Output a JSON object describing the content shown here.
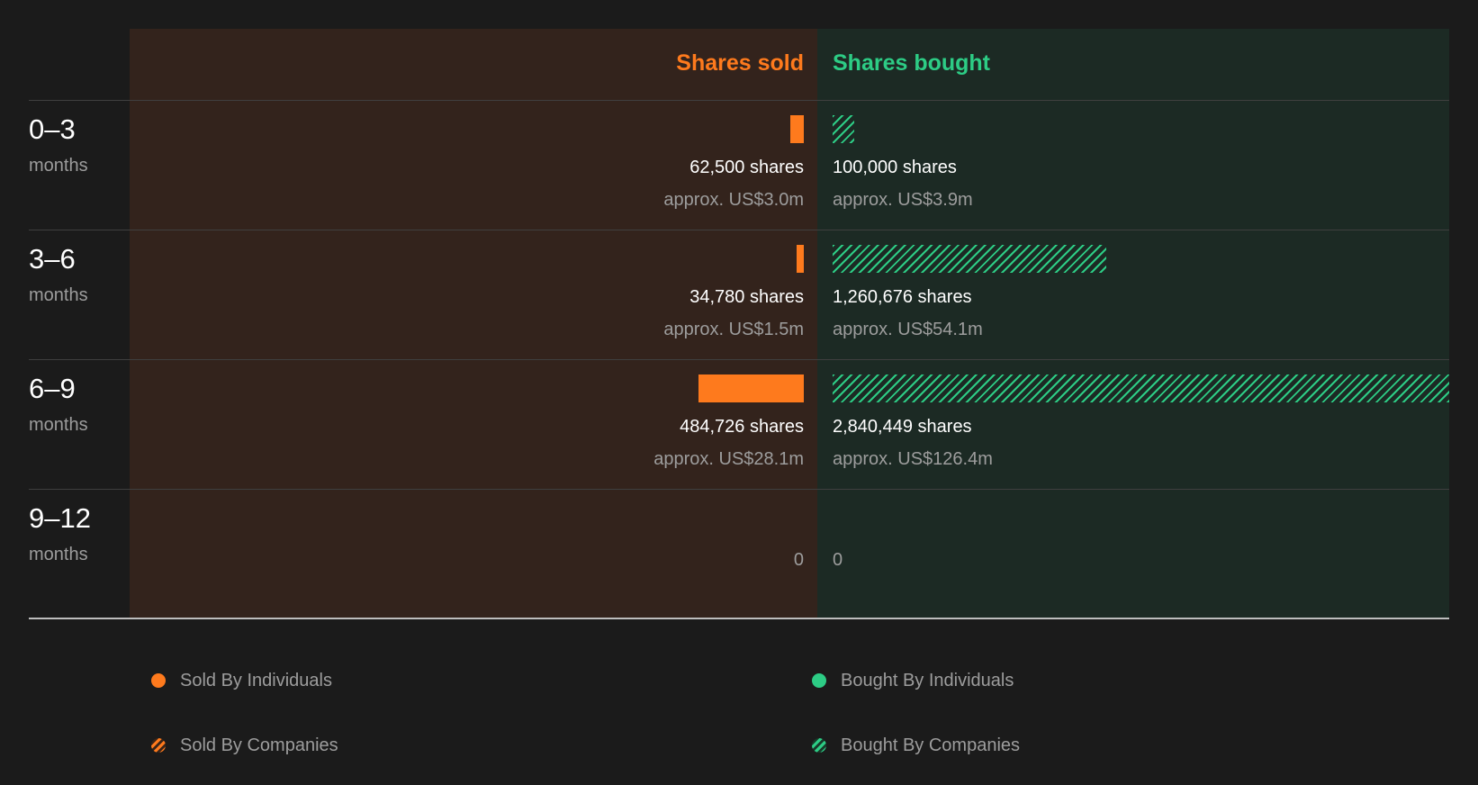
{
  "chart_data": {
    "type": "bar",
    "headers": {
      "sold": "Shares sold",
      "bought": "Shares bought"
    },
    "periods": [
      {
        "range": "0–3",
        "unit": "months",
        "sold": {
          "shares": 62500,
          "shares_label": "62,500 shares",
          "approx_label": "approx. US$3.0m"
        },
        "bought": {
          "shares": 100000,
          "shares_label": "100,000 shares",
          "approx_label": "approx. US$3.9m"
        }
      },
      {
        "range": "3–6",
        "unit": "months",
        "sold": {
          "shares": 34780,
          "shares_label": "34,780 shares",
          "approx_label": "approx. US$1.5m"
        },
        "bought": {
          "shares": 1260676,
          "shares_label": "1,260,676 shares",
          "approx_label": "approx. US$54.1m"
        }
      },
      {
        "range": "6–9",
        "unit": "months",
        "sold": {
          "shares": 484726,
          "shares_label": "484,726 shares",
          "approx_label": "approx. US$28.1m"
        },
        "bought": {
          "shares": 2840449,
          "shares_label": "2,840,449 shares",
          "approx_label": "approx. US$126.4m"
        }
      },
      {
        "range": "9–12",
        "unit": "months",
        "sold": {
          "shares": 0,
          "shares_label": "0",
          "approx_label": ""
        },
        "bought": {
          "shares": 0,
          "shares_label": "0",
          "approx_label": ""
        }
      }
    ],
    "legend": [
      {
        "label": "Sold By Individuals",
        "color": "#fe7a1d",
        "style": "solid"
      },
      {
        "label": "Bought By Individuals",
        "color": "#2dcc85",
        "style": "solid"
      },
      {
        "label": "Sold By Companies",
        "color": "#fe7a1d",
        "style": "hatched"
      },
      {
        "label": "Bought By Companies",
        "color": "#2dcc85",
        "style": "hatched"
      }
    ],
    "colors": {
      "sold": "#fe7a1d",
      "bought": "#2dcc85",
      "sold_panel": "#33231c",
      "bought_panel": "#1c2a24"
    }
  }
}
